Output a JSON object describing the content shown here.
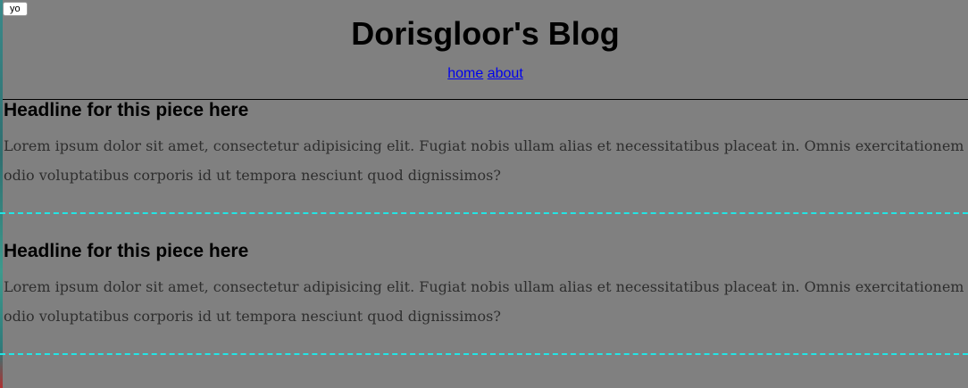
{
  "debug_button": {
    "label": "yo"
  },
  "header": {
    "title": "Dorisgloor's Blog",
    "nav": [
      {
        "label": "home"
      },
      {
        "label": "about"
      }
    ]
  },
  "posts": [
    {
      "headline": "Headline for this piece here",
      "body_line_1": "Lorem ipsum dolor sit amet, consectetur adipisicing elit. Fugiat nobis ullam alias et necessitatibus placeat in. Omnis exercitationem totam",
      "body_line_2": "odio voluptatibus corporis id ut tempora nesciunt quod dignissimos?"
    },
    {
      "headline": "Headline for this piece here",
      "body_line_1": "Lorem ipsum dolor sit amet, consectetur adipisicing elit. Fugiat nobis ullam alias et necessitatibus placeat in. Omnis exercitationem totam",
      "body_line_2": "odio voluptatibus corporis id ut tempora nesciunt quod dignissimos?"
    }
  ],
  "colors": {
    "page_background": "#808080",
    "link": "#0000ee",
    "divider": "#22e6e6"
  }
}
